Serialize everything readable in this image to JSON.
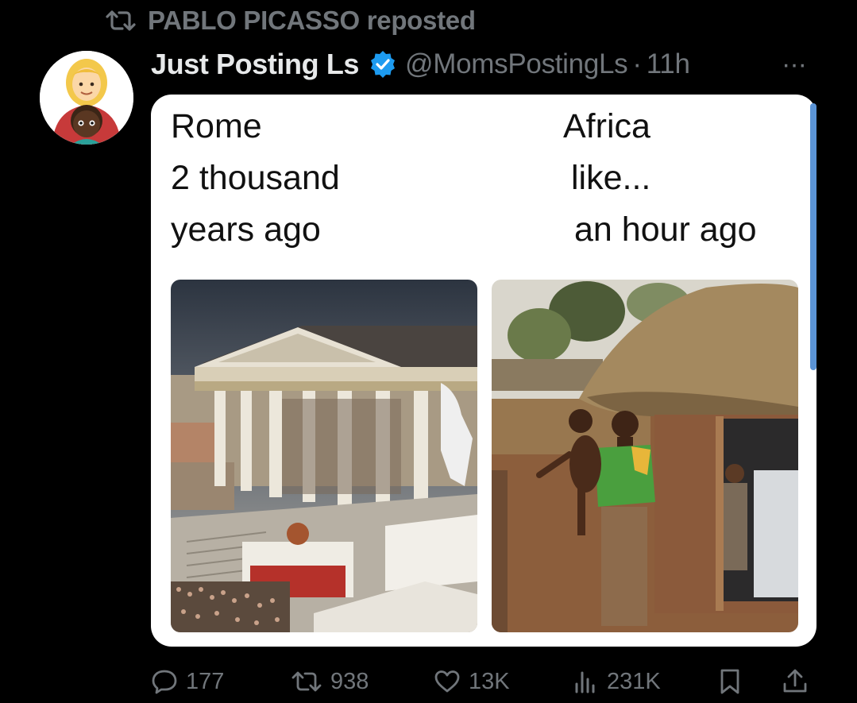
{
  "repost": {
    "label": "PABLO PICASSO reposted"
  },
  "tweet": {
    "display_name": "Just Posting Ls",
    "handle": "@MomsPostingLs",
    "separator": "·",
    "time": "11h",
    "more_label": "···"
  },
  "meme": {
    "left_caption": "Rome\n2 thousand\nyears ago",
    "right_caption_1": "Africa",
    "right_caption_2": "like...",
    "right_caption_3": "an hour ago"
  },
  "actions": {
    "replies": "177",
    "reposts": "938",
    "likes": "13K",
    "views": "231K"
  },
  "colors": {
    "background": "#000000",
    "muted_text": "#71767b",
    "primary_text": "#e7e9ea",
    "verified_blue": "#1d9bf0"
  },
  "icons": [
    "repost-icon",
    "verified-badge-icon",
    "more-icon",
    "reply-icon",
    "like-icon",
    "views-icon",
    "bookmark-icon",
    "share-icon"
  ]
}
